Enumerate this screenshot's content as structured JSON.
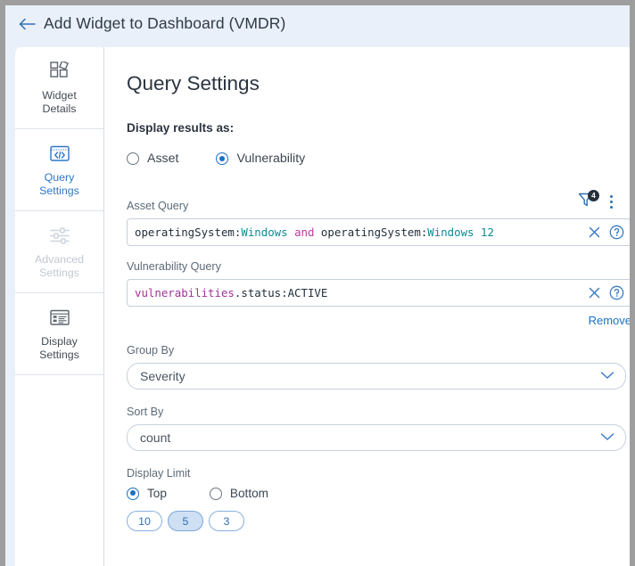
{
  "header": {
    "back_icon": "arrow-left-icon",
    "title": "Add Widget to Dashboard (VMDR)"
  },
  "sidebar": {
    "items": [
      {
        "id": "widget-details",
        "label": "Widget\nDetails",
        "icon": "widgets-icon",
        "state": "default"
      },
      {
        "id": "query-settings",
        "label": "Query\nSettings",
        "icon": "code-icon",
        "state": "active"
      },
      {
        "id": "advanced-settings",
        "label": "Advanced\nSettings",
        "icon": "sliders-icon",
        "state": "disabled"
      },
      {
        "id": "display-settings",
        "label": "Display\nSettings",
        "icon": "layout-icon",
        "state": "default"
      }
    ]
  },
  "main": {
    "page_title": "Query Settings",
    "display_results_label": "Display results as:",
    "result_type_options": [
      {
        "label": "Asset",
        "selected": false
      },
      {
        "label": "Vulnerability",
        "selected": true
      }
    ],
    "asset_query": {
      "label": "Asset Query",
      "filter_icon": "filter-funnel-icon",
      "filter_badge_count": "4",
      "kebab_icon": "more-vertical-icon",
      "value": "operatingSystem:Windows and operatingSystem:Windows 12",
      "tokens": [
        {
          "text": "operatingSystem",
          "kind": "key"
        },
        {
          "text": ":",
          "kind": "plain"
        },
        {
          "text": "Windows",
          "kind": "val"
        },
        {
          "text": " ",
          "kind": "plain"
        },
        {
          "text": "and",
          "kind": "op"
        },
        {
          "text": " ",
          "kind": "plain"
        },
        {
          "text": "operatingSystem",
          "kind": "key"
        },
        {
          "text": ":",
          "kind": "plain"
        },
        {
          "text": "Windows",
          "kind": "val"
        },
        {
          "text": " ",
          "kind": "plain"
        },
        {
          "text": "12",
          "kind": "num"
        }
      ],
      "clear_icon": "close-x-icon",
      "help_icon": "question-circle-icon"
    },
    "vulnerability_query": {
      "label": "Vulnerability Query",
      "value": "vulnerabilities.status:ACTIVE",
      "tokens": [
        {
          "text": "vulnerabilities",
          "kind": "obj"
        },
        {
          "text": ".status:ACTIVE",
          "kind": "plain"
        }
      ],
      "clear_icon": "close-x-icon",
      "help_icon": "question-circle-icon",
      "remove_label": "Remove"
    },
    "group_by": {
      "label": "Group By",
      "value": "Severity",
      "chevron_icon": "chevron-down-icon"
    },
    "sort_by": {
      "label": "Sort By",
      "value": "count",
      "chevron_icon": "chevron-down-icon"
    },
    "display_limit": {
      "label": "Display Limit",
      "direction_options": [
        {
          "label": "Top",
          "selected": true
        },
        {
          "label": "Bottom",
          "selected": false
        }
      ],
      "chips": [
        {
          "label": "10",
          "selected": false
        },
        {
          "label": "5",
          "selected": true
        },
        {
          "label": "3",
          "selected": false
        }
      ]
    }
  },
  "colors": {
    "accent_blue": "#1a6fc4",
    "header_bg": "#eaf0f9",
    "badge_dark": "#25303b",
    "chip_selected_bg": "#cfe0f4"
  }
}
